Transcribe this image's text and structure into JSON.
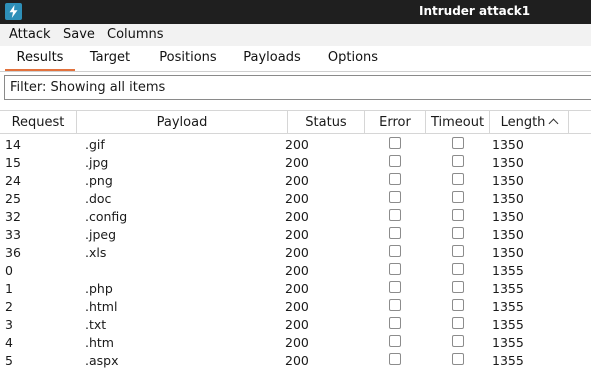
{
  "window": {
    "title": "Intruder attack1",
    "icon": "burp-lightning-icon"
  },
  "menu": {
    "items": [
      "Attack",
      "Save",
      "Columns"
    ]
  },
  "tabs": [
    {
      "label": "Results",
      "active": true
    },
    {
      "label": "Target",
      "active": false
    },
    {
      "label": "Positions",
      "active": false
    },
    {
      "label": "Payloads",
      "active": false
    },
    {
      "label": "Options",
      "active": false
    }
  ],
  "filter": {
    "text": "Filter: Showing all items"
  },
  "table": {
    "columns": [
      "Request",
      "Payload",
      "Status",
      "Error",
      "Timeout",
      "Length"
    ],
    "sort": {
      "column": "Length",
      "direction": "ascending"
    },
    "rows": [
      {
        "request": "14",
        "payload": ".gif",
        "status": "200",
        "error": false,
        "timeout": false,
        "length": "1350"
      },
      {
        "request": "15",
        "payload": ".jpg",
        "status": "200",
        "error": false,
        "timeout": false,
        "length": "1350"
      },
      {
        "request": "24",
        "payload": ".png",
        "status": "200",
        "error": false,
        "timeout": false,
        "length": "1350"
      },
      {
        "request": "25",
        "payload": ".doc",
        "status": "200",
        "error": false,
        "timeout": false,
        "length": "1350"
      },
      {
        "request": "32",
        "payload": ".config",
        "status": "200",
        "error": false,
        "timeout": false,
        "length": "1350"
      },
      {
        "request": "33",
        "payload": ".jpeg",
        "status": "200",
        "error": false,
        "timeout": false,
        "length": "1350"
      },
      {
        "request": "36",
        "payload": ".xls",
        "status": "200",
        "error": false,
        "timeout": false,
        "length": "1350"
      },
      {
        "request": "0",
        "payload": "",
        "status": "200",
        "error": false,
        "timeout": false,
        "length": "1355"
      },
      {
        "request": "1",
        "payload": ".php",
        "status": "200",
        "error": false,
        "timeout": false,
        "length": "1355"
      },
      {
        "request": "2",
        "payload": ".html",
        "status": "200",
        "error": false,
        "timeout": false,
        "length": "1355"
      },
      {
        "request": "3",
        "payload": ".txt",
        "status": "200",
        "error": false,
        "timeout": false,
        "length": "1355"
      },
      {
        "request": "4",
        "payload": ".htm",
        "status": "200",
        "error": false,
        "timeout": false,
        "length": "1355"
      },
      {
        "request": "5",
        "payload": ".aspx",
        "status": "200",
        "error": false,
        "timeout": false,
        "length": "1355"
      }
    ]
  },
  "colors": {
    "titlebar": "#1f1f1f",
    "active_tab_accent": "#e2723d",
    "app_icon": "#2e8fb8"
  }
}
